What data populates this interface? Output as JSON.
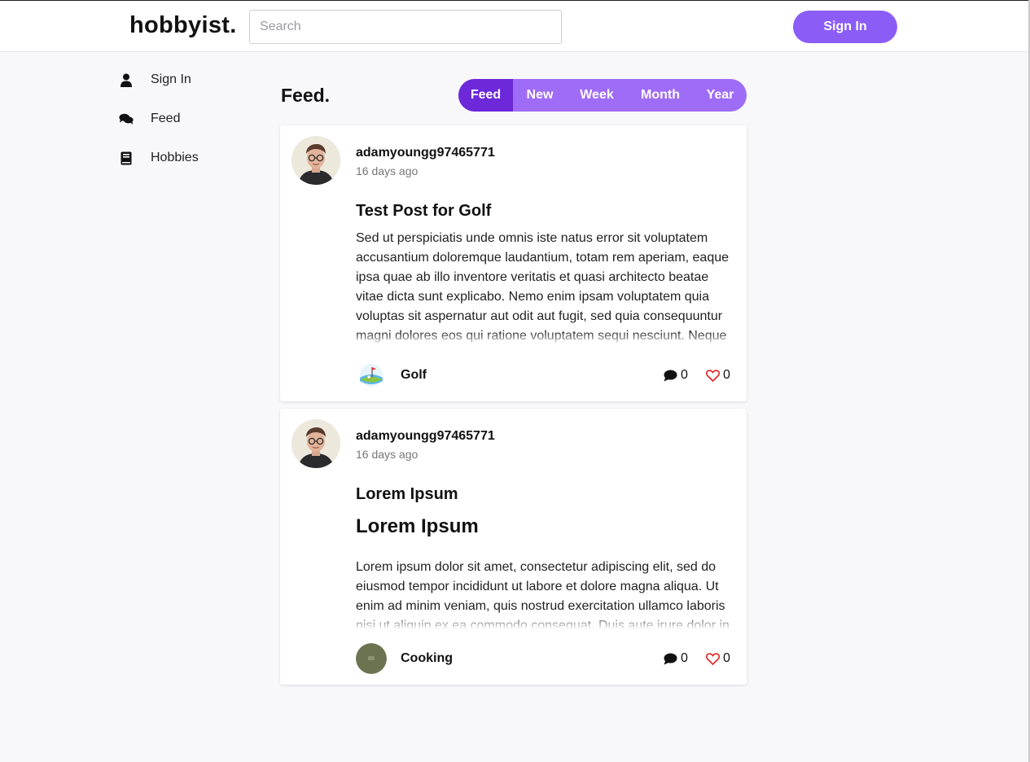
{
  "app": {
    "logo": "hobbyist."
  },
  "search": {
    "placeholder": "Search"
  },
  "header": {
    "signin_label": "Sign In"
  },
  "sidebar": {
    "items": [
      {
        "label": "Sign In",
        "icon": "user-icon"
      },
      {
        "label": "Feed",
        "icon": "comments-icon"
      },
      {
        "label": "Hobbies",
        "icon": "book-icon"
      }
    ]
  },
  "feed": {
    "title": "Feed.",
    "tabs": [
      "Feed",
      "New",
      "Week",
      "Month",
      "Year"
    ],
    "active_tab": "Feed"
  },
  "posts": [
    {
      "username": "adamyoungg97465771",
      "time": "16 days ago",
      "title": "Test Post for Golf",
      "heading": "",
      "body": "Sed ut perspiciatis unde omnis iste natus error sit voluptatem accusantium doloremque laudantium, totam rem aperiam, eaque ipsa quae ab illo inventore veritatis et quasi architecto beatae vitae dicta sunt explicabo. Nemo enim ipsam voluptatem quia voluptas sit aspernatur aut odit aut fugit, sed quia consequuntur magni dolores eos qui ratione voluptatem sequi nesciunt. Neque",
      "hobby": "Golf",
      "comments": "0",
      "likes": "0"
    },
    {
      "username": "adamyoungg97465771",
      "time": "16 days ago",
      "title": "Lorem Ipsum",
      "heading": "Lorem Ipsum",
      "body": "Lorem ipsum dolor sit amet, consectetur adipiscing elit, sed do eiusmod tempor incididunt ut labore et dolore magna aliqua. Ut enim ad minim veniam, quis nostrud exercitation ullamco laboris nisi ut aliquip ex ea commodo consequat. Duis aute irure dolor in",
      "hobby": "Cooking",
      "comments": "0",
      "likes": "0"
    }
  ],
  "colors": {
    "accent": "#8b5cf6",
    "accent_dark": "#6d28d9",
    "like_red": "#e02424"
  }
}
